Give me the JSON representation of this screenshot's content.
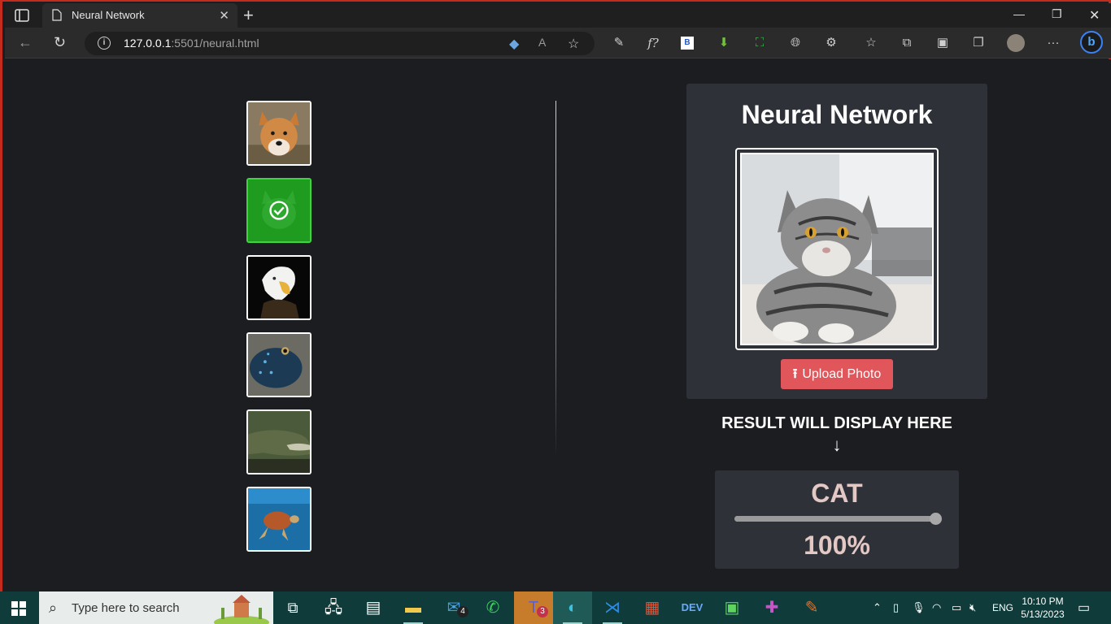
{
  "browser": {
    "tab_title": "Neural Network",
    "url_host": "127.0.0.1",
    "url_rest": ":5501/neural.html"
  },
  "page": {
    "heading": "Neural Network",
    "upload_label": "Upload Photo",
    "result_label": "RESULT WILL DISPLAY HERE",
    "result_arrow": "↓",
    "result_class": "CAT",
    "result_percent_text": "100%",
    "confidence": 1.0,
    "thumbnails": [
      {
        "name": "dog",
        "selected": false
      },
      {
        "name": "cat",
        "selected": true
      },
      {
        "name": "eagle",
        "selected": false
      },
      {
        "name": "fish",
        "selected": false
      },
      {
        "name": "crocodile",
        "selected": false
      },
      {
        "name": "turtle",
        "selected": false
      }
    ]
  },
  "taskbar": {
    "search_placeholder": "Type here to search",
    "mail_badge": "4",
    "teams_badge": "3",
    "language": "ENG",
    "time": "10:10 PM",
    "date": "5/13/2023"
  }
}
